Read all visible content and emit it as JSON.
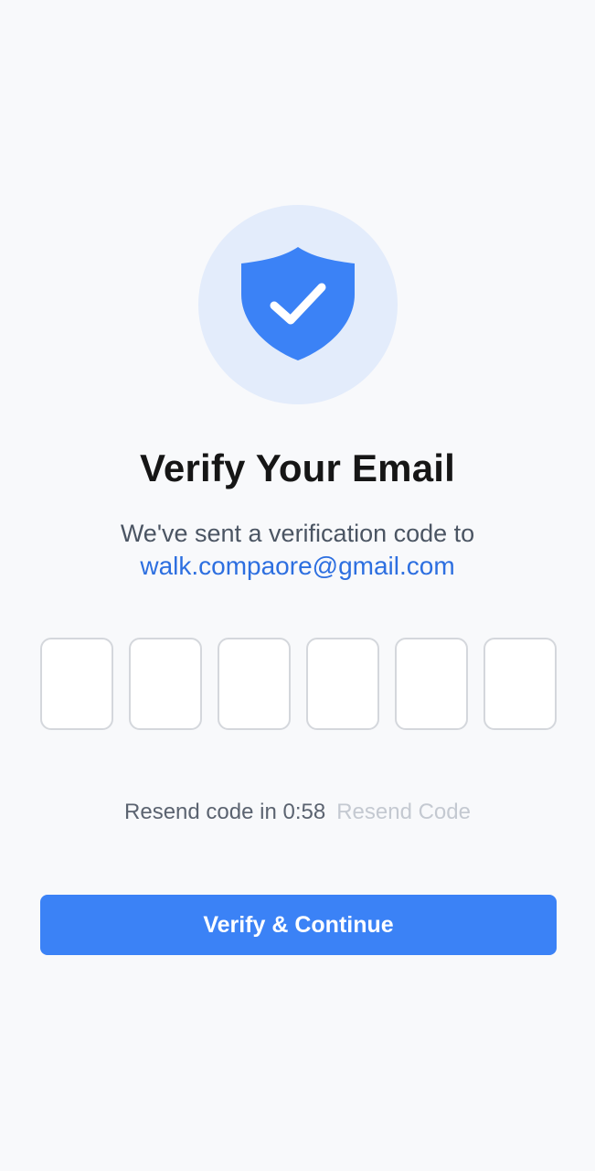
{
  "header": {
    "icon": "shield-check-icon",
    "title": "Verify Your Email",
    "subtitle": "We've sent a verification code to",
    "email": "walk.compaore@gmail.com"
  },
  "code": {
    "digits": [
      "",
      "",
      "",
      "",
      "",
      ""
    ]
  },
  "resend": {
    "countdown_text": "Resend code in 0:58",
    "link_label": "Resend Code"
  },
  "actions": {
    "verify_label": "Verify & Continue"
  },
  "colors": {
    "background": "#f8f9fb",
    "accent": "#3b82f6",
    "email_link": "#2d6fe0",
    "icon_circle": "#e3ecfb",
    "disabled_link": "#c4c9d1"
  }
}
